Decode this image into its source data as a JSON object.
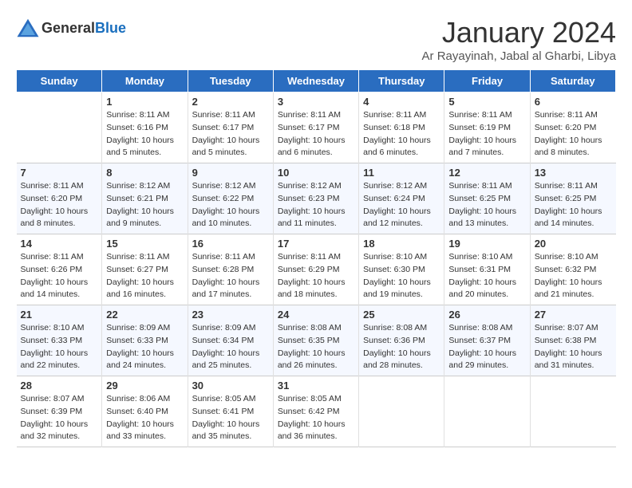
{
  "header": {
    "logo_general": "General",
    "logo_blue": "Blue",
    "month_title": "January 2024",
    "subtitle": "Ar Rayayinah, Jabal al Gharbi, Libya"
  },
  "days_of_week": [
    "Sunday",
    "Monday",
    "Tuesday",
    "Wednesday",
    "Thursday",
    "Friday",
    "Saturday"
  ],
  "weeks": [
    [
      {
        "day": "",
        "sunrise": "",
        "sunset": "",
        "daylight": ""
      },
      {
        "day": "1",
        "sunrise": "Sunrise: 8:11 AM",
        "sunset": "Sunset: 6:16 PM",
        "daylight": "Daylight: 10 hours and 5 minutes."
      },
      {
        "day": "2",
        "sunrise": "Sunrise: 8:11 AM",
        "sunset": "Sunset: 6:17 PM",
        "daylight": "Daylight: 10 hours and 5 minutes."
      },
      {
        "day": "3",
        "sunrise": "Sunrise: 8:11 AM",
        "sunset": "Sunset: 6:17 PM",
        "daylight": "Daylight: 10 hours and 6 minutes."
      },
      {
        "day": "4",
        "sunrise": "Sunrise: 8:11 AM",
        "sunset": "Sunset: 6:18 PM",
        "daylight": "Daylight: 10 hours and 6 minutes."
      },
      {
        "day": "5",
        "sunrise": "Sunrise: 8:11 AM",
        "sunset": "Sunset: 6:19 PM",
        "daylight": "Daylight: 10 hours and 7 minutes."
      },
      {
        "day": "6",
        "sunrise": "Sunrise: 8:11 AM",
        "sunset": "Sunset: 6:20 PM",
        "daylight": "Daylight: 10 hours and 8 minutes."
      }
    ],
    [
      {
        "day": "7",
        "sunrise": "Sunrise: 8:11 AM",
        "sunset": "Sunset: 6:20 PM",
        "daylight": "Daylight: 10 hours and 8 minutes."
      },
      {
        "day": "8",
        "sunrise": "Sunrise: 8:12 AM",
        "sunset": "Sunset: 6:21 PM",
        "daylight": "Daylight: 10 hours and 9 minutes."
      },
      {
        "day": "9",
        "sunrise": "Sunrise: 8:12 AM",
        "sunset": "Sunset: 6:22 PM",
        "daylight": "Daylight: 10 hours and 10 minutes."
      },
      {
        "day": "10",
        "sunrise": "Sunrise: 8:12 AM",
        "sunset": "Sunset: 6:23 PM",
        "daylight": "Daylight: 10 hours and 11 minutes."
      },
      {
        "day": "11",
        "sunrise": "Sunrise: 8:12 AM",
        "sunset": "Sunset: 6:24 PM",
        "daylight": "Daylight: 10 hours and 12 minutes."
      },
      {
        "day": "12",
        "sunrise": "Sunrise: 8:11 AM",
        "sunset": "Sunset: 6:25 PM",
        "daylight": "Daylight: 10 hours and 13 minutes."
      },
      {
        "day": "13",
        "sunrise": "Sunrise: 8:11 AM",
        "sunset": "Sunset: 6:25 PM",
        "daylight": "Daylight: 10 hours and 14 minutes."
      }
    ],
    [
      {
        "day": "14",
        "sunrise": "Sunrise: 8:11 AM",
        "sunset": "Sunset: 6:26 PM",
        "daylight": "Daylight: 10 hours and 14 minutes."
      },
      {
        "day": "15",
        "sunrise": "Sunrise: 8:11 AM",
        "sunset": "Sunset: 6:27 PM",
        "daylight": "Daylight: 10 hours and 16 minutes."
      },
      {
        "day": "16",
        "sunrise": "Sunrise: 8:11 AM",
        "sunset": "Sunset: 6:28 PM",
        "daylight": "Daylight: 10 hours and 17 minutes."
      },
      {
        "day": "17",
        "sunrise": "Sunrise: 8:11 AM",
        "sunset": "Sunset: 6:29 PM",
        "daylight": "Daylight: 10 hours and 18 minutes."
      },
      {
        "day": "18",
        "sunrise": "Sunrise: 8:10 AM",
        "sunset": "Sunset: 6:30 PM",
        "daylight": "Daylight: 10 hours and 19 minutes."
      },
      {
        "day": "19",
        "sunrise": "Sunrise: 8:10 AM",
        "sunset": "Sunset: 6:31 PM",
        "daylight": "Daylight: 10 hours and 20 minutes."
      },
      {
        "day": "20",
        "sunrise": "Sunrise: 8:10 AM",
        "sunset": "Sunset: 6:32 PM",
        "daylight": "Daylight: 10 hours and 21 minutes."
      }
    ],
    [
      {
        "day": "21",
        "sunrise": "Sunrise: 8:10 AM",
        "sunset": "Sunset: 6:33 PM",
        "daylight": "Daylight: 10 hours and 22 minutes."
      },
      {
        "day": "22",
        "sunrise": "Sunrise: 8:09 AM",
        "sunset": "Sunset: 6:33 PM",
        "daylight": "Daylight: 10 hours and 24 minutes."
      },
      {
        "day": "23",
        "sunrise": "Sunrise: 8:09 AM",
        "sunset": "Sunset: 6:34 PM",
        "daylight": "Daylight: 10 hours and 25 minutes."
      },
      {
        "day": "24",
        "sunrise": "Sunrise: 8:08 AM",
        "sunset": "Sunset: 6:35 PM",
        "daylight": "Daylight: 10 hours and 26 minutes."
      },
      {
        "day": "25",
        "sunrise": "Sunrise: 8:08 AM",
        "sunset": "Sunset: 6:36 PM",
        "daylight": "Daylight: 10 hours and 28 minutes."
      },
      {
        "day": "26",
        "sunrise": "Sunrise: 8:08 AM",
        "sunset": "Sunset: 6:37 PM",
        "daylight": "Daylight: 10 hours and 29 minutes."
      },
      {
        "day": "27",
        "sunrise": "Sunrise: 8:07 AM",
        "sunset": "Sunset: 6:38 PM",
        "daylight": "Daylight: 10 hours and 31 minutes."
      }
    ],
    [
      {
        "day": "28",
        "sunrise": "Sunrise: 8:07 AM",
        "sunset": "Sunset: 6:39 PM",
        "daylight": "Daylight: 10 hours and 32 minutes."
      },
      {
        "day": "29",
        "sunrise": "Sunrise: 8:06 AM",
        "sunset": "Sunset: 6:40 PM",
        "daylight": "Daylight: 10 hours and 33 minutes."
      },
      {
        "day": "30",
        "sunrise": "Sunrise: 8:05 AM",
        "sunset": "Sunset: 6:41 PM",
        "daylight": "Daylight: 10 hours and 35 minutes."
      },
      {
        "day": "31",
        "sunrise": "Sunrise: 8:05 AM",
        "sunset": "Sunset: 6:42 PM",
        "daylight": "Daylight: 10 hours and 36 minutes."
      },
      {
        "day": "",
        "sunrise": "",
        "sunset": "",
        "daylight": ""
      },
      {
        "day": "",
        "sunrise": "",
        "sunset": "",
        "daylight": ""
      },
      {
        "day": "",
        "sunrise": "",
        "sunset": "",
        "daylight": ""
      }
    ]
  ]
}
